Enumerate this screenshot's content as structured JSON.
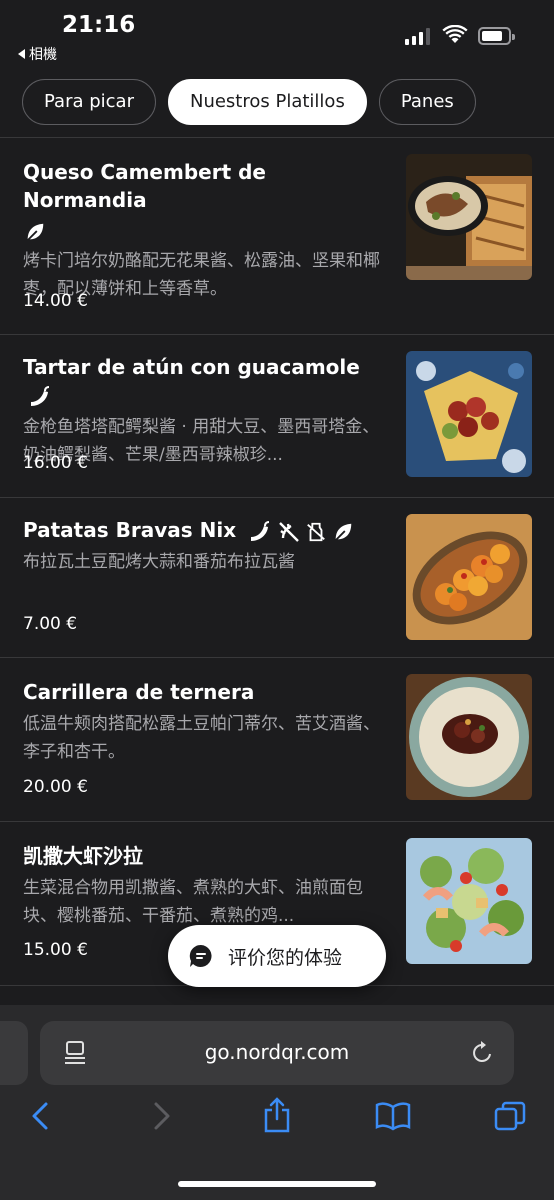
{
  "status": {
    "time": "21:16",
    "back_app": "相機"
  },
  "tabs": [
    {
      "label": "Para picar",
      "active": false
    },
    {
      "label": "Nuestros Platillos",
      "active": true
    },
    {
      "label": "Panes",
      "active": false
    }
  ],
  "items": [
    {
      "name": "Queso Camembert de Normandia",
      "desc": "烤卡门培尔奶酪配无花果酱、松露油、坚果和椰枣，配以薄饼和上等香草。",
      "price": "14.00 €",
      "icons": [
        "leaf-icon"
      ]
    },
    {
      "name": "Tartar de atún con guacamole",
      "desc": "金枪鱼塔塔配鳄梨酱 · 用甜大豆、墨西哥塔金、奶油鳄梨酱、芒果/墨西哥辣椒珍...",
      "price": "16.00 €",
      "icons": [
        "chili-icon"
      ]
    },
    {
      "name": "Patatas Bravas Nix",
      "desc": "布拉瓦土豆配烤大蒜和番茄布拉瓦酱",
      "price": "7.00 €",
      "icons": [
        "chili-icon",
        "no-gluten-icon",
        "no-dairy-icon",
        "leaf-icon"
      ]
    },
    {
      "name": "Carrillera de ternera",
      "desc": "低温牛颊肉搭配松露土豆帕门蒂尔、苦艾酒酱、李子和杏干。",
      "price": "20.00 €",
      "icons": []
    },
    {
      "name": "凯撒大虾沙拉",
      "desc": "生菜混合物用凯撒酱、煮熟的大虾、油煎面包块、樱桃番茄、干番茄、煮熟的鸡...",
      "price": "15.00 €",
      "icons": []
    }
  ],
  "feedback": {
    "label": "评价您的体验"
  },
  "browser": {
    "url": "go.nordqr.com"
  },
  "colors": {
    "background": "#1c1c1e",
    "divider": "#38383a",
    "toolbar_blue": "#3b8cf5"
  }
}
